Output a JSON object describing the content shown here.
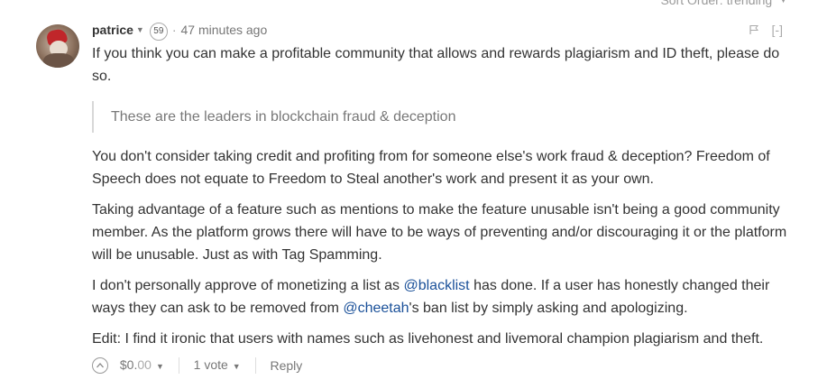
{
  "sort": {
    "label": "Sort Order:",
    "value": "trending"
  },
  "comment": {
    "author": "patrice",
    "reputation": "59",
    "time": "47 minutes ago",
    "collapse_label": "[-]",
    "paragraph_1": "If you think you can make a profitable community that allows and rewards plagiarism and ID theft, please do so.",
    "quote": "These are the leaders in blockchain fraud & deception",
    "paragraph_2": "You don't consider taking credit and profiting from for someone else's work fraud & deception? Freedom of Speech does not equate to Freedom to Steal another's work and present it as your own.",
    "paragraph_3": "Taking advantage of a feature such as mentions to make the feature unusable isn't being a good community member. As the platform grows there will have to be ways of preventing and/or discouraging it or the platform will be unusable. Just as with Tag Spamming.",
    "paragraph_4": {
      "part1": "I don't personally approve of monetizing a list as ",
      "mention1": "@blacklist",
      "part2": " has done. If a user has honestly changed their ways they can ask to be removed from ",
      "mention2": "@cheetah",
      "part3": "'s ban list by simply asking and apologizing."
    },
    "paragraph_5": "Edit: I find it ironic that users with names such as livehonest and livemoral champion plagiarism and theft."
  },
  "footer": {
    "payout_main": "$0.",
    "payout_cents": "00",
    "votes": "1 vote",
    "reply_label": "Reply"
  },
  "colors": {
    "link": "#1a5099",
    "muted": "#777777",
    "text": "#333333"
  },
  "icons": [
    "chevron-down-icon",
    "flag-icon",
    "upvote-icon"
  ]
}
